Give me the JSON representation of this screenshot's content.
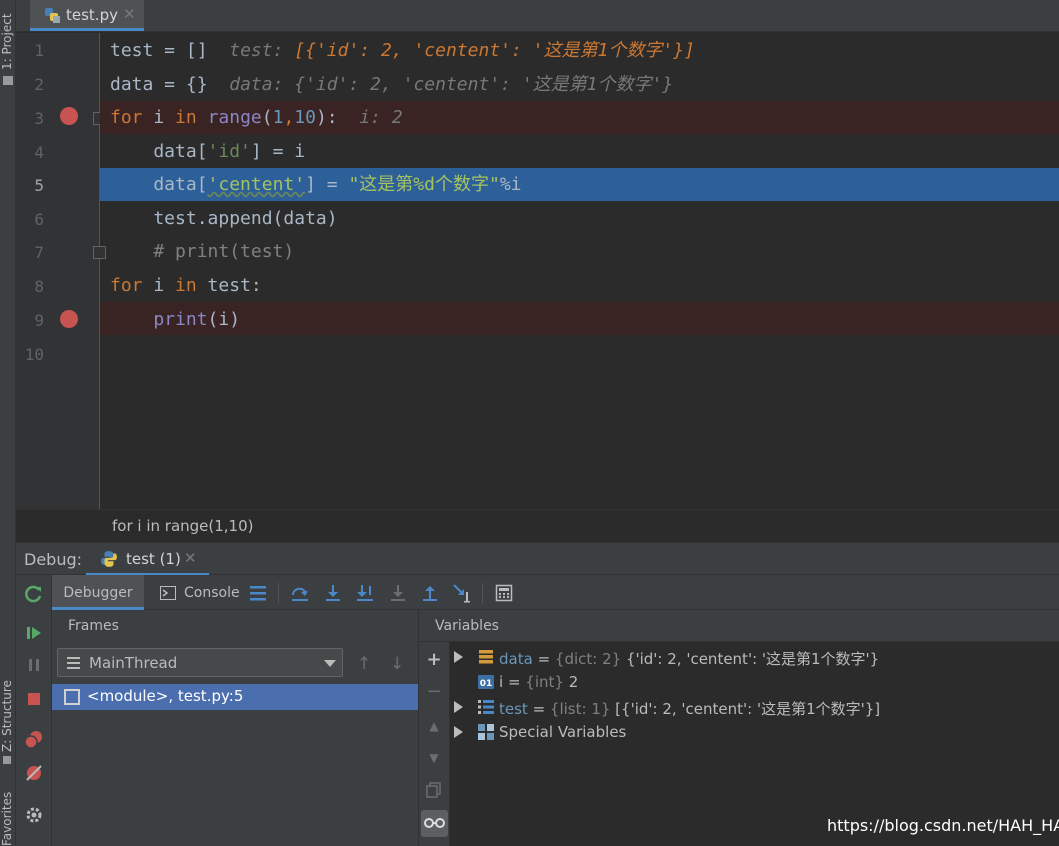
{
  "left_strip": {
    "project_label": "1: Project",
    "structure_label": "Z: Structure",
    "favorites_label": "Favorites"
  },
  "editor": {
    "tab": {
      "filename": "test.py",
      "close": "✕"
    },
    "lines": [
      {
        "num": "1"
      },
      {
        "num": "2"
      },
      {
        "num": "3"
      },
      {
        "num": "4"
      },
      {
        "num": "5"
      },
      {
        "num": "6"
      },
      {
        "num": "7"
      },
      {
        "num": "8"
      },
      {
        "num": "9"
      },
      {
        "num": "10"
      }
    ],
    "code": {
      "l1_a": "test = []",
      "l1_hint_label": "test: ",
      "l1_hint_value": "[{'id': 2, 'centent': '这是第1个数字'}]",
      "l2_a": "data = {}",
      "l2_hint": "data: {'id': 2, 'centent': '这是第1个数字'}",
      "l3_for": "for",
      "l3_i": " i ",
      "l3_in": "in",
      "l3_sp": " ",
      "l3_range": "range",
      "l3_open": "(",
      "l3_n1": "1",
      "l3_comma": ",",
      "l3_n2": "10",
      "l3_close": "):",
      "l3_hint": "i: 2",
      "l4_a": "    data[",
      "l4_str": "'id'",
      "l4_b": "] = i",
      "l5_a": "    data[",
      "l5_str": "'centent'",
      "l5_b": "] = ",
      "l5_str2": "\"这是第%d个数字\"",
      "l5_c": "%i",
      "l6_a": "    test.append(data)",
      "l7_comment": "    # print(test)",
      "l8_for": "for",
      "l8_i": " i ",
      "l8_in": "in",
      "l8_b": " test:",
      "l9_indent": "    ",
      "l9_print": "print",
      "l9_b": "(i)"
    },
    "current_line": 5,
    "breakpoint_lines": [
      3,
      9
    ]
  },
  "breadcrumb": "for i in range(1,10)",
  "debug": {
    "title": "Debug:",
    "session_tab": "test (1)",
    "session_close": "✕",
    "tabs": {
      "debugger": "Debugger",
      "console": "Console"
    },
    "frames": {
      "title": "Frames",
      "thread": "MainThread",
      "selected_frame": "<module>, test.py:5"
    },
    "variables": {
      "title": "Variables",
      "rows": [
        {
          "name": "data",
          "eq": " = ",
          "type": "{dict: 2}",
          "value": " {'id': 2, 'centent': '这是第1个数字'}",
          "expandable": true,
          "icon": "dict-icon"
        },
        {
          "name": "i",
          "eq": " = ",
          "type": "{int}",
          "value": " 2",
          "expandable": false,
          "icon": "int-icon"
        },
        {
          "name": "test",
          "eq": " = ",
          "type": "{list: 1}",
          "value": " [{'id': 2, 'centent': '这是第1个数字'}]",
          "expandable": true,
          "icon": "list-icon"
        },
        {
          "name": "Special Variables",
          "eq": "",
          "type": "",
          "value": "",
          "expandable": true,
          "icon": "special-vars-icon"
        }
      ]
    }
  },
  "watermark": "https://blog.csdn.net/HAH_HAH",
  "colors": {
    "accent": "#4a88c7",
    "breakpoint": "#c75450",
    "execution_line": "#2d6099",
    "selection": "#4b6eaf"
  }
}
